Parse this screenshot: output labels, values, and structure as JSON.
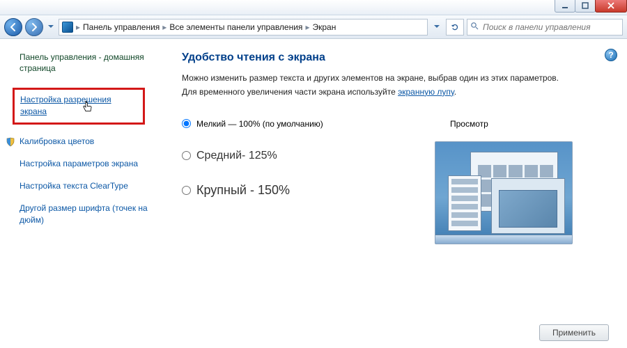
{
  "breadcrumb": {
    "items": [
      "Панель управления",
      "Все элементы панели управления",
      "Экран"
    ]
  },
  "search": {
    "placeholder": "Поиск в панели управления"
  },
  "sidebar": {
    "home": "Панель управления - домашняя страница",
    "resolution": "Настройка разрешения экрана",
    "calibration": "Калибровка цветов",
    "params": "Настройка параметров экрана",
    "cleartype": "Настройка текста ClearType",
    "dpi": "Другой размер шрифта (точек на дюйм)"
  },
  "main": {
    "title": "Удобство чтения с экрана",
    "desc1": "Можно изменить размер текста и других элементов на экране, выбрав один из этих параметров.",
    "desc2_prefix": "Для временного увеличения части экрана используйте ",
    "desc2_link": "экранную лупу",
    "desc2_suffix": ".",
    "preview_label": "Просмотр",
    "options": {
      "small": "Мелкий — 100% (по умолчанию)",
      "medium": "Средний- 125%",
      "large": "Крупный - 150%"
    },
    "apply": "Применить"
  }
}
